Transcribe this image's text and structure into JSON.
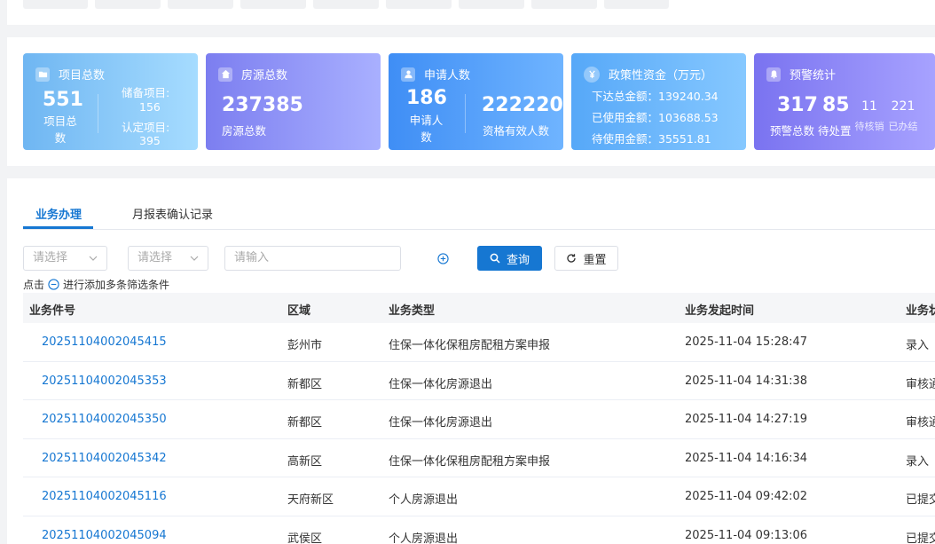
{
  "stats": {
    "projects": {
      "title": "项目总数",
      "icon": "folder-icon",
      "total_value": "551",
      "total_label": "项目总数",
      "reserve_label": "储备项目:",
      "reserve_value": "156",
      "confirmed_label": "认定项目:",
      "confirmed_value": "395",
      "gradient": [
        "#6fb6f2",
        "#a6dcff"
      ]
    },
    "housing": {
      "title": "房源总数",
      "icon": "house-icon",
      "value": "237385",
      "label": "房源总数",
      "gradient": [
        "#7c7ef0",
        "#a9b0ff"
      ]
    },
    "applicants": {
      "title": "申请人数",
      "icon": "person-icon",
      "applicant_value": "186",
      "applicant_label": "申请人数",
      "qualified_value": "222220",
      "qualified_label": "资格有效人数",
      "gradient": [
        "#3f8ef5",
        "#6fb4ff"
      ]
    },
    "funds": {
      "title": "政策性资金（万元）",
      "icon": "yuan-icon",
      "lines": [
        {
          "label": "下达总金额：",
          "value": "139240.34"
        },
        {
          "label": "已使用金额：",
          "value": "103688.53"
        },
        {
          "label": "待使用金额：",
          "value": "35551.81"
        }
      ],
      "gradient": [
        "#56a8f8",
        "#86c8ff"
      ]
    },
    "alerts": {
      "title": "预警统计",
      "icon": "bell-icon",
      "total_value": "317",
      "total_label": "预警总数",
      "pending_value": "85",
      "pending_label": "待处置",
      "to_cancel_value": "11",
      "to_cancel_label": "待核销",
      "done_value": "221",
      "done_label": "已办结",
      "gradient": [
        "#7a73f0",
        "#a7a2ff"
      ]
    }
  },
  "tabs": [
    "业务办理",
    "月报表确认记录"
  ],
  "filters": {
    "select1_placeholder": "请选择",
    "select2_placeholder": "请选择",
    "input_placeholder": "请输入",
    "search_label": "查询",
    "reset_label": "重置",
    "hint_prefix": "点击",
    "hint_suffix": "进行添加多条筛选条件"
  },
  "table": {
    "headers": [
      "业务件号",
      "区域",
      "业务类型",
      "业务发起时间",
      "业务状"
    ],
    "rows": [
      [
        "20251104002045415",
        "彭州市",
        "住保一体化保租房配租方案申报",
        "2025-11-04 15:28:47",
        "录入"
      ],
      [
        "20251104002045353",
        "新都区",
        "住保一体化房源退出",
        "2025-11-04 14:31:38",
        "审核通"
      ],
      [
        "20251104002045350",
        "新都区",
        "住保一体化房源退出",
        "2025-11-04 14:27:19",
        "审核通"
      ],
      [
        "20251104002045342",
        "高新区",
        "住保一体化保租房配租方案申报",
        "2025-11-04 14:16:34",
        "录入"
      ],
      [
        "20251104002045116",
        "天府新区",
        "个人房源退出",
        "2025-11-04 09:42:02",
        "已提交"
      ],
      [
        "20251104002045094",
        "武侯区",
        "个人房源退出",
        "2025-11-04 09:13:06",
        "已提交"
      ]
    ]
  }
}
